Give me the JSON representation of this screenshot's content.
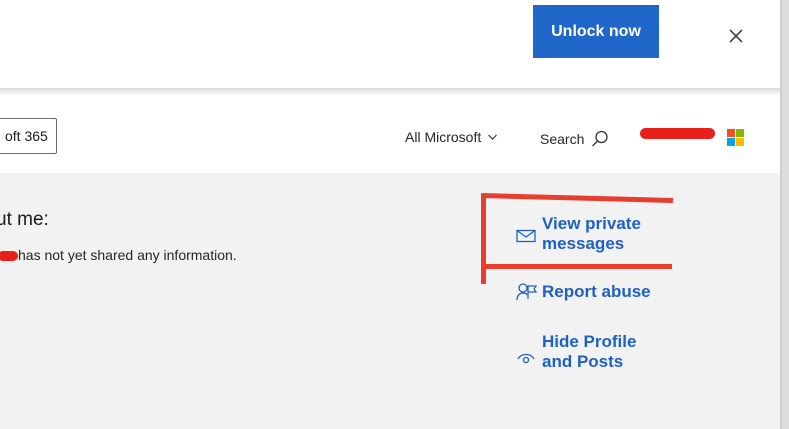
{
  "banner": {
    "unlock_label": "Unlock now"
  },
  "header": {
    "product_tag": "oft 365",
    "all_microsoft_label": "All Microsoft",
    "search_label": "Search"
  },
  "main": {
    "about_heading": "ut me:",
    "about_text": "has not yet shared any information.",
    "links": {
      "view_private": "View private\nmessages",
      "report_abuse": "Report abuse",
      "hide_profile": "Hide Profile\nand Posts"
    }
  },
  "colors": {
    "accent": "#1f67c9",
    "link": "#1f60c4",
    "redaction": "#e8201a",
    "content_bg": "#f2f2f2"
  },
  "icons": [
    "close-icon",
    "chevron-down-icon",
    "search-icon",
    "microsoft-logo-icon",
    "envelope-icon",
    "report-person-icon",
    "eye-icon"
  ]
}
